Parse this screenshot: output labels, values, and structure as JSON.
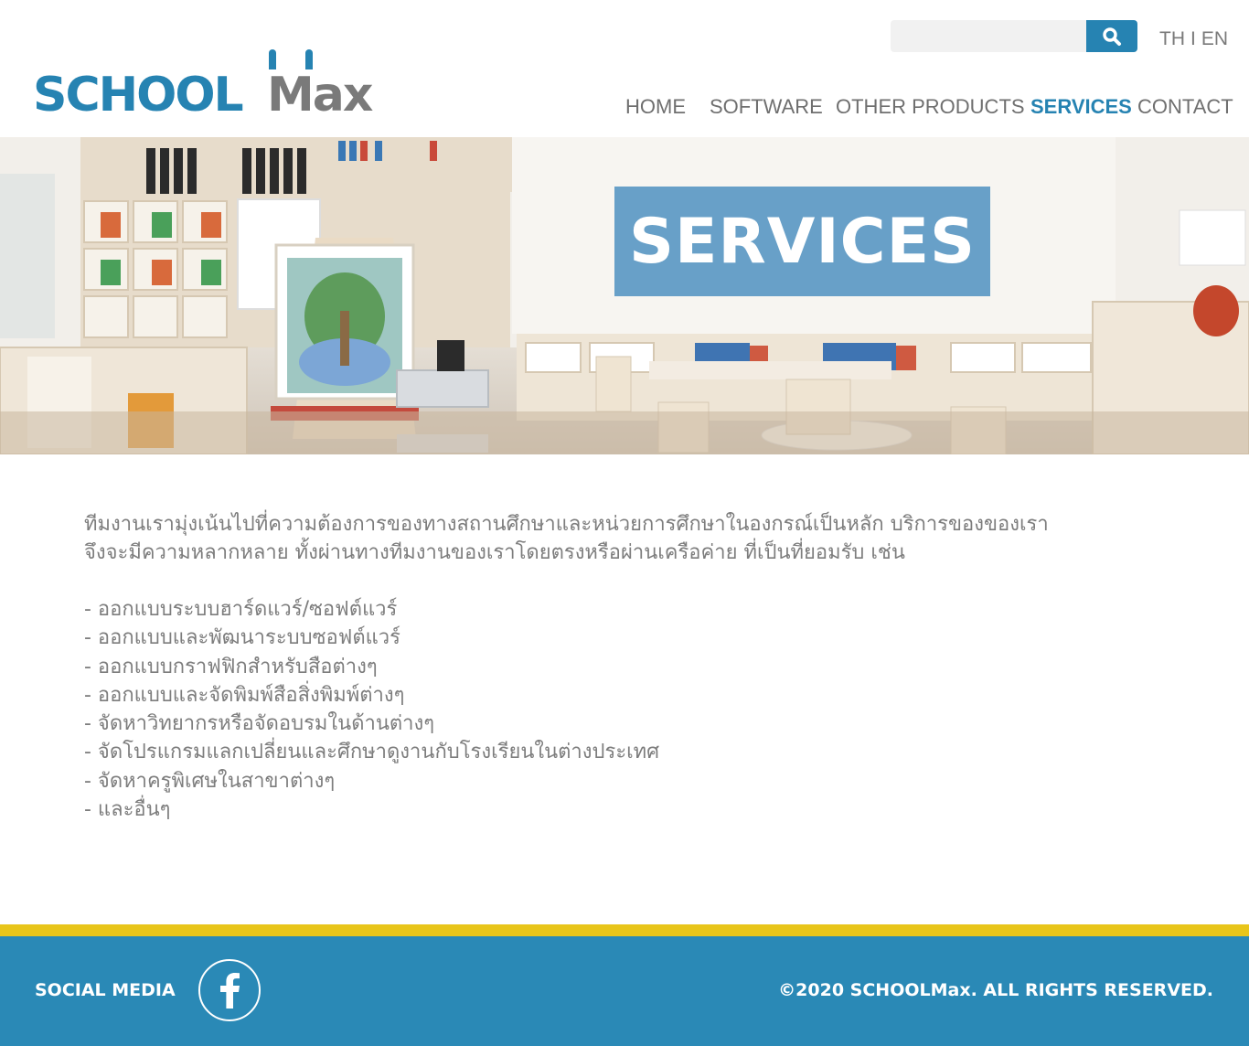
{
  "brand": {
    "logo_school": "SCHOOL",
    "logo_max": "Max",
    "primary_color": "#2683b2",
    "secondary_color": "#7a7a7a",
    "accent_color": "#e8c51a"
  },
  "search": {
    "placeholder": "",
    "value": "",
    "icon": "search-icon"
  },
  "lang": {
    "th": "TH",
    "separator": "I",
    "en": "EN"
  },
  "nav": {
    "items": [
      {
        "label": "HOME",
        "active": false
      },
      {
        "label": "SOFTWARE",
        "active": false
      },
      {
        "label": "OTHER PRODUCTS",
        "active": false
      },
      {
        "label": "SERVICES",
        "active": true
      },
      {
        "label": "CONTACT",
        "active": false
      }
    ]
  },
  "hero": {
    "title": "SERVICES",
    "image": "classroom-photo"
  },
  "content": {
    "intro": [
      "ทีมงานเรามุ่งเน้นไปที่ความต้องการของทางสถานศึกษาและหน่วยการศึกษาในองกรณ์เป็นหลัก บริการของของเรา",
      "จึงจะมีความหลากหลาย ทั้งผ่านทางทีมงานของเราโดยตรงหรือผ่านเครือค่าย ที่เป็นที่ยอมรับ เช่น"
    ],
    "services": [
      "- ออกแบบระบบฮาร์ดแวร์/ซอฟต์แวร์",
      "- ออกแบบและพัฒนาระบบซอฟต์แวร์",
      "- ออกแบบกราฟฟิกสำหรับสือต่างๆ",
      "- ออกแบบและจัดพิมพ์สือสิ่งพิมพ์ต่างๆ",
      "- จัดหาวิทยากรหรือจัดอบรมในด้านต่างๆ",
      "- จัดโปรแกรมแลกเปลี่ยนและศึกษาดูงานกับโรงเรียนในต่างประเทศ",
      "- จัดหาครูพิเศษในสาขาต่างๆ",
      "- และอื่นๆ"
    ]
  },
  "footer": {
    "social_label": "SOCIAL MEDIA",
    "facebook_icon": "facebook-icon",
    "copyright": "©2020 SCHOOLMax. ALL RIGHTS RESERVED."
  }
}
